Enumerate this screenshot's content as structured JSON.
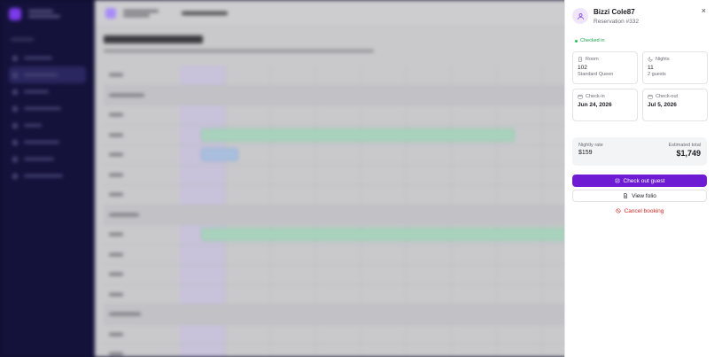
{
  "drawer": {
    "guest_name": "Bizzi Cole87",
    "reservation": "Reservation #332",
    "status": "Checked in",
    "room_label": "Room",
    "room_value": "102",
    "room_sub": "Standard Queen",
    "nights_label": "Nights",
    "nights_value": "11",
    "nights_sub": "2 guests",
    "checkin_label": "Check-in",
    "checkin_value": "Jun 24, 2026",
    "checkout_label": "Check-out",
    "checkout_value": "Jul 5, 2026",
    "nightly_label": "Nightly rate",
    "nightly_value": "$159",
    "total_label": "Estimated total",
    "total_value": "$1,749",
    "checkout_button": "Check out guest",
    "folio_button": "View folio",
    "cancel_button": "Cancel booking",
    "close_symbol": "×"
  },
  "background_page": {
    "title": "Reservation Timeline"
  },
  "colors": {
    "accent": "#6d1cd4",
    "status_green": "#16a34a",
    "danger": "#dc2626",
    "sidebar": "#14123a"
  }
}
